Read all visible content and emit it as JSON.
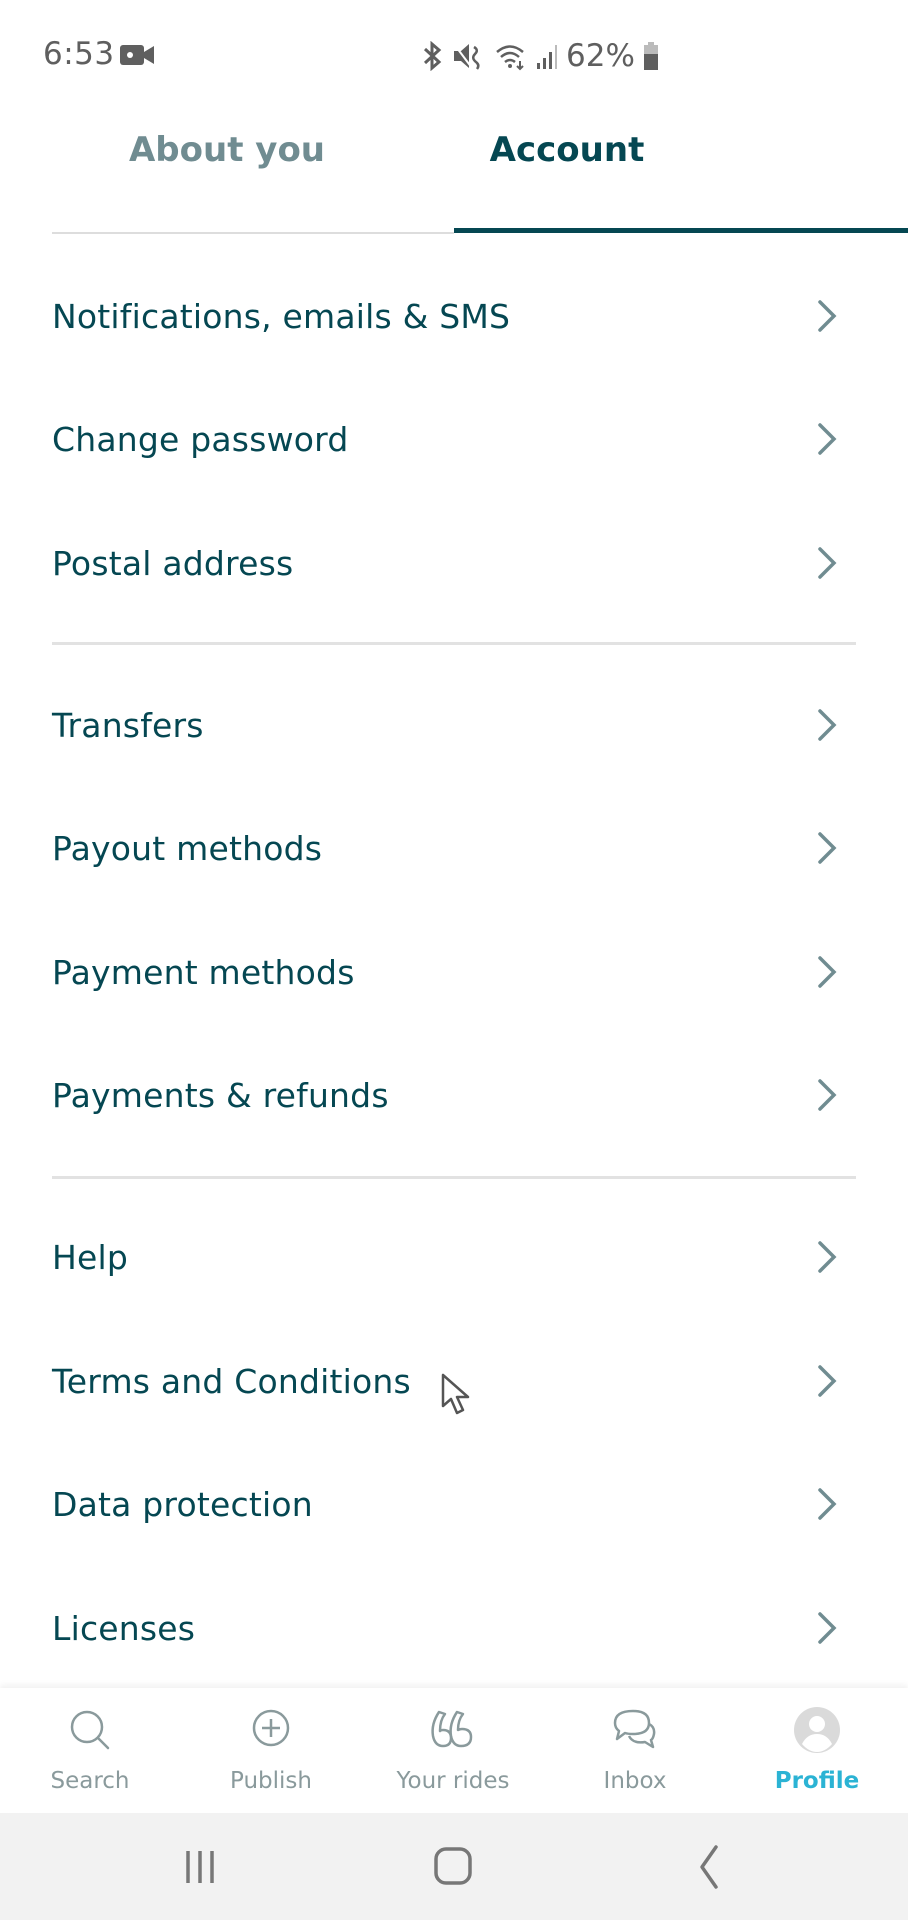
{
  "status_bar": {
    "time": "6:53",
    "battery_percent": "62%",
    "icons": [
      "video-recording-icon",
      "bluetooth-icon",
      "mute-icon",
      "wifi-icon",
      "signal-icon",
      "battery-icon"
    ]
  },
  "tabs": [
    {
      "label": "About you",
      "active": false
    },
    {
      "label": "Account",
      "active": true
    }
  ],
  "menu": {
    "groups": [
      [
        "Notifications, emails & SMS",
        "Change password",
        "Postal address"
      ],
      [
        "Transfers",
        "Payout methods",
        "Payment methods",
        "Payments & refunds"
      ],
      [
        "Help",
        "Terms and Conditions",
        "Data protection",
        "Licenses"
      ]
    ],
    "chevron_icon": "chevron-right-icon"
  },
  "bottom_nav": {
    "items": [
      {
        "label": "Search",
        "icon": "search-icon",
        "active": false
      },
      {
        "label": "Publish",
        "icon": "plus-circle-icon",
        "active": false
      },
      {
        "label": "Your rides",
        "icon": "rides-icon",
        "active": false
      },
      {
        "label": "Inbox",
        "icon": "chat-icon",
        "active": false
      },
      {
        "label": "Profile",
        "icon": "profile-avatar-icon",
        "active": true
      }
    ]
  },
  "system_nav": {
    "buttons": [
      "recent-apps",
      "home",
      "back"
    ]
  },
  "colors": {
    "primary": "#054752",
    "inactive_tab": "#708c91",
    "accent_active": "#2bb3d4",
    "divider": "#e2e2e2"
  }
}
